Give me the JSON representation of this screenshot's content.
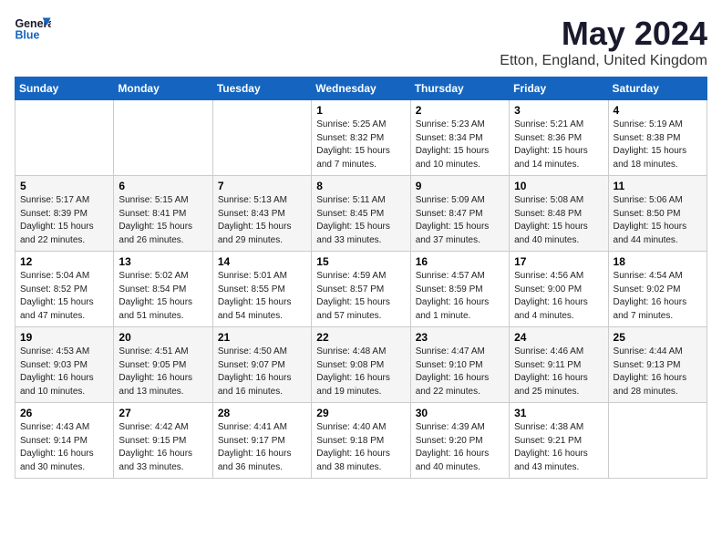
{
  "header": {
    "logo_line1": "General",
    "logo_line2": "Blue",
    "month": "May 2024",
    "location": "Etton, England, United Kingdom"
  },
  "weekdays": [
    "Sunday",
    "Monday",
    "Tuesday",
    "Wednesday",
    "Thursday",
    "Friday",
    "Saturday"
  ],
  "weeks": [
    [
      {
        "day": "",
        "info": ""
      },
      {
        "day": "",
        "info": ""
      },
      {
        "day": "",
        "info": ""
      },
      {
        "day": "1",
        "info": "Sunrise: 5:25 AM\nSunset: 8:32 PM\nDaylight: 15 hours\nand 7 minutes."
      },
      {
        "day": "2",
        "info": "Sunrise: 5:23 AM\nSunset: 8:34 PM\nDaylight: 15 hours\nand 10 minutes."
      },
      {
        "day": "3",
        "info": "Sunrise: 5:21 AM\nSunset: 8:36 PM\nDaylight: 15 hours\nand 14 minutes."
      },
      {
        "day": "4",
        "info": "Sunrise: 5:19 AM\nSunset: 8:38 PM\nDaylight: 15 hours\nand 18 minutes."
      }
    ],
    [
      {
        "day": "5",
        "info": "Sunrise: 5:17 AM\nSunset: 8:39 PM\nDaylight: 15 hours\nand 22 minutes."
      },
      {
        "day": "6",
        "info": "Sunrise: 5:15 AM\nSunset: 8:41 PM\nDaylight: 15 hours\nand 26 minutes."
      },
      {
        "day": "7",
        "info": "Sunrise: 5:13 AM\nSunset: 8:43 PM\nDaylight: 15 hours\nand 29 minutes."
      },
      {
        "day": "8",
        "info": "Sunrise: 5:11 AM\nSunset: 8:45 PM\nDaylight: 15 hours\nand 33 minutes."
      },
      {
        "day": "9",
        "info": "Sunrise: 5:09 AM\nSunset: 8:47 PM\nDaylight: 15 hours\nand 37 minutes."
      },
      {
        "day": "10",
        "info": "Sunrise: 5:08 AM\nSunset: 8:48 PM\nDaylight: 15 hours\nand 40 minutes."
      },
      {
        "day": "11",
        "info": "Sunrise: 5:06 AM\nSunset: 8:50 PM\nDaylight: 15 hours\nand 44 minutes."
      }
    ],
    [
      {
        "day": "12",
        "info": "Sunrise: 5:04 AM\nSunset: 8:52 PM\nDaylight: 15 hours\nand 47 minutes."
      },
      {
        "day": "13",
        "info": "Sunrise: 5:02 AM\nSunset: 8:54 PM\nDaylight: 15 hours\nand 51 minutes."
      },
      {
        "day": "14",
        "info": "Sunrise: 5:01 AM\nSunset: 8:55 PM\nDaylight: 15 hours\nand 54 minutes."
      },
      {
        "day": "15",
        "info": "Sunrise: 4:59 AM\nSunset: 8:57 PM\nDaylight: 15 hours\nand 57 minutes."
      },
      {
        "day": "16",
        "info": "Sunrise: 4:57 AM\nSunset: 8:59 PM\nDaylight: 16 hours\nand 1 minute."
      },
      {
        "day": "17",
        "info": "Sunrise: 4:56 AM\nSunset: 9:00 PM\nDaylight: 16 hours\nand 4 minutes."
      },
      {
        "day": "18",
        "info": "Sunrise: 4:54 AM\nSunset: 9:02 PM\nDaylight: 16 hours\nand 7 minutes."
      }
    ],
    [
      {
        "day": "19",
        "info": "Sunrise: 4:53 AM\nSunset: 9:03 PM\nDaylight: 16 hours\nand 10 minutes."
      },
      {
        "day": "20",
        "info": "Sunrise: 4:51 AM\nSunset: 9:05 PM\nDaylight: 16 hours\nand 13 minutes."
      },
      {
        "day": "21",
        "info": "Sunrise: 4:50 AM\nSunset: 9:07 PM\nDaylight: 16 hours\nand 16 minutes."
      },
      {
        "day": "22",
        "info": "Sunrise: 4:48 AM\nSunset: 9:08 PM\nDaylight: 16 hours\nand 19 minutes."
      },
      {
        "day": "23",
        "info": "Sunrise: 4:47 AM\nSunset: 9:10 PM\nDaylight: 16 hours\nand 22 minutes."
      },
      {
        "day": "24",
        "info": "Sunrise: 4:46 AM\nSunset: 9:11 PM\nDaylight: 16 hours\nand 25 minutes."
      },
      {
        "day": "25",
        "info": "Sunrise: 4:44 AM\nSunset: 9:13 PM\nDaylight: 16 hours\nand 28 minutes."
      }
    ],
    [
      {
        "day": "26",
        "info": "Sunrise: 4:43 AM\nSunset: 9:14 PM\nDaylight: 16 hours\nand 30 minutes."
      },
      {
        "day": "27",
        "info": "Sunrise: 4:42 AM\nSunset: 9:15 PM\nDaylight: 16 hours\nand 33 minutes."
      },
      {
        "day": "28",
        "info": "Sunrise: 4:41 AM\nSunset: 9:17 PM\nDaylight: 16 hours\nand 36 minutes."
      },
      {
        "day": "29",
        "info": "Sunrise: 4:40 AM\nSunset: 9:18 PM\nDaylight: 16 hours\nand 38 minutes."
      },
      {
        "day": "30",
        "info": "Sunrise: 4:39 AM\nSunset: 9:20 PM\nDaylight: 16 hours\nand 40 minutes."
      },
      {
        "day": "31",
        "info": "Sunrise: 4:38 AM\nSunset: 9:21 PM\nDaylight: 16 hours\nand 43 minutes."
      },
      {
        "day": "",
        "info": ""
      }
    ]
  ]
}
